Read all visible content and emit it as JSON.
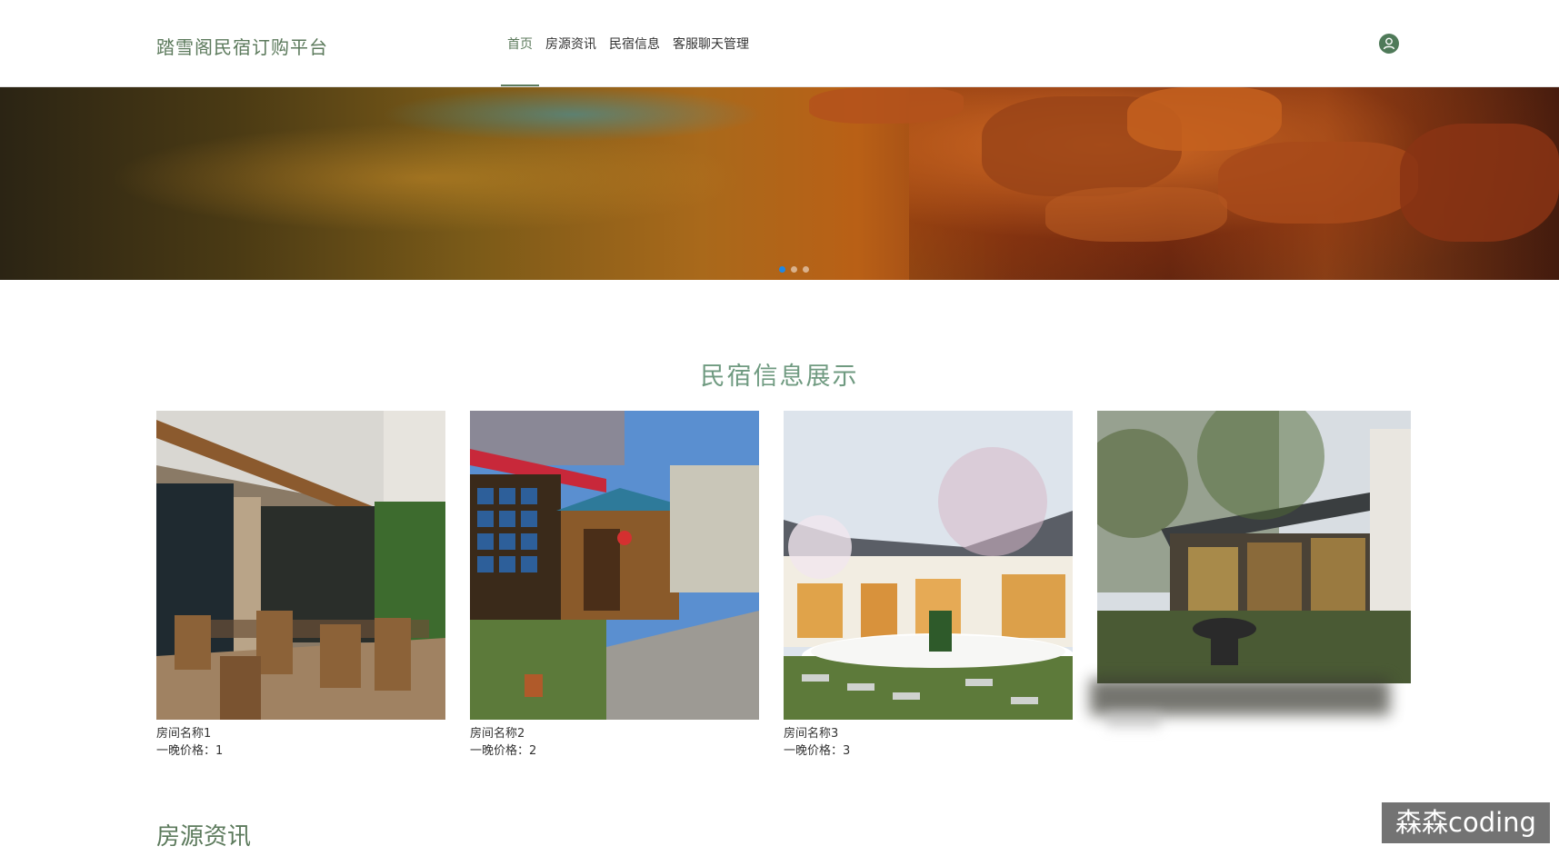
{
  "header": {
    "logo": "踏雪阁民宿订购平台",
    "nav": [
      {
        "label": "首页",
        "active": true
      },
      {
        "label": "房源资讯",
        "active": false
      },
      {
        "label": "民宿信息",
        "active": false
      },
      {
        "label": "客服聊天管理",
        "active": false
      }
    ],
    "avatar_icon": "user-icon",
    "accent": "#5c7a5c"
  },
  "banner": {
    "slides": 3,
    "active_slide": 1,
    "dot_active_color": "#1e88e5"
  },
  "featured": {
    "title": "民宿信息展示",
    "rooms": [
      {
        "name": "房间名称1",
        "price": "一晚价格：1"
      },
      {
        "name": "房间名称2",
        "price": "一晚价格：2"
      },
      {
        "name": "房间名称3",
        "price": "一晚价格：3"
      },
      {
        "name": "",
        "price": ""
      }
    ]
  },
  "news": {
    "title": "房源资讯"
  },
  "watermark": "森森coding"
}
